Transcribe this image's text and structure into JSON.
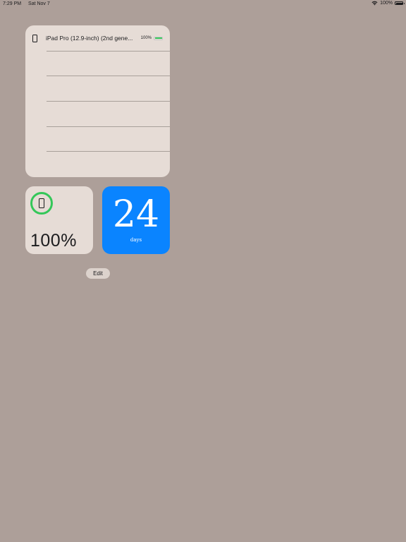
{
  "status_bar": {
    "time": "7:29 PM",
    "date": "Sat Nov 7",
    "battery_text": "100%",
    "battery_level": 1.0
  },
  "batteries_widget": {
    "device_name": "iPad Pro (12.9-inch) (2nd gene...",
    "battery_percent": "100%",
    "battery_level": 1.0,
    "battery_color": "#34c759"
  },
  "battery_widget": {
    "percent": "100%",
    "level": 1.0,
    "ring_color": "#34c759"
  },
  "countdown_widget": {
    "number": "24",
    "unit": "days",
    "background_color": "#0a84ff"
  },
  "edit_button": {
    "label": "Edit"
  },
  "colors": {
    "wallpaper": "#ad9f99",
    "widget_background": "#e6dcd6"
  }
}
